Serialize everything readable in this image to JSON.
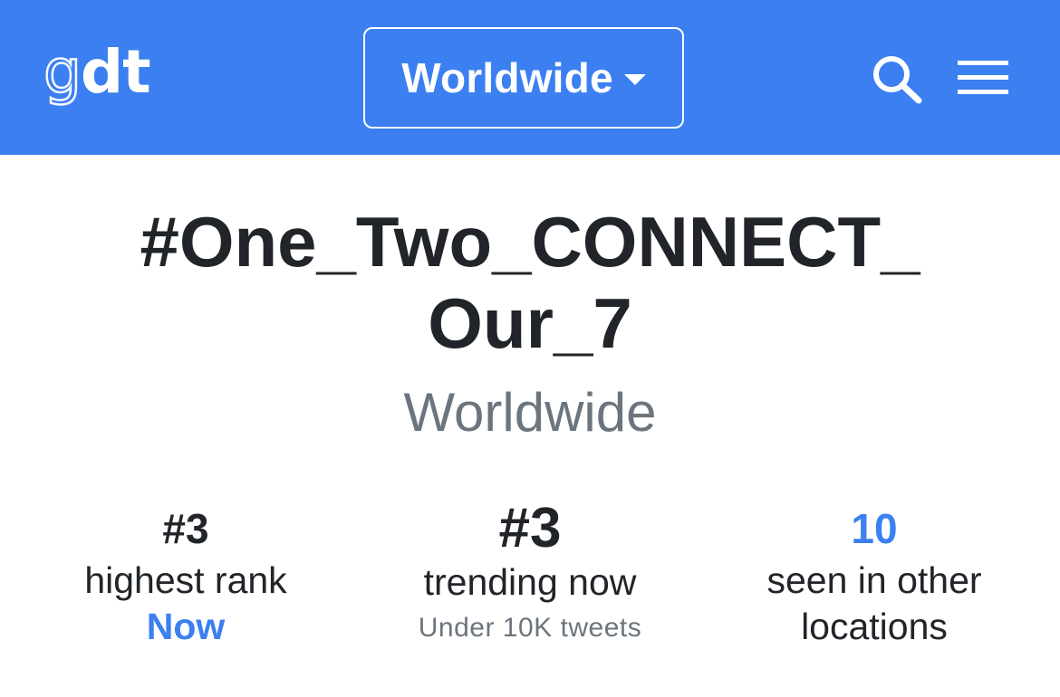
{
  "navbar": {
    "logo_light": "g",
    "logo_bold": "dt",
    "location_label": "Worldwide",
    "search_icon": "search-icon",
    "menu_icon": "hamburger-menu-icon",
    "background_color": "#3b7ff1"
  },
  "trend": {
    "title_line1": "#One_Two_CONNECT_",
    "title_line2": "Our_7",
    "location": "Worldwide"
  },
  "stats": {
    "highest_rank": {
      "value": "#3",
      "caption": "highest rank",
      "detail": "Now"
    },
    "trending_now": {
      "value": "#3",
      "caption": "trending now",
      "detail": "Under 10K tweets"
    },
    "other_locations": {
      "value": "10",
      "caption_line1": "seen in other",
      "caption_line2": "locations"
    }
  },
  "colors": {
    "accent": "#3b7ff1",
    "text": "#212529",
    "muted": "#6c757d"
  }
}
